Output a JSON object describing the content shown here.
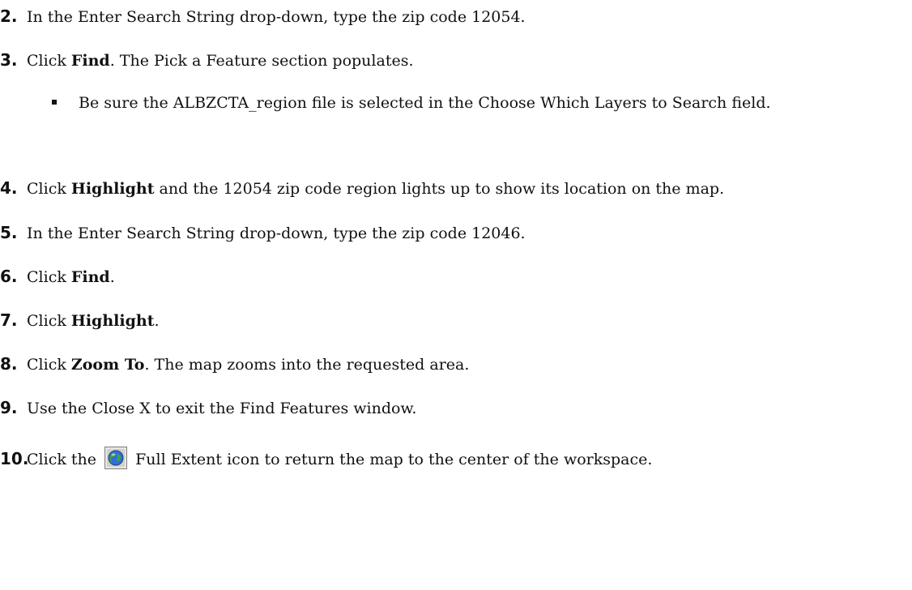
{
  "steps": [
    {
      "number": "2.",
      "text": "In the Enter Search String drop-down, type the zip code 12054."
    },
    {
      "number": "3.",
      "pre": "Click ",
      "bold": "Find",
      "post": ". The Pick a Feature section populates."
    },
    {
      "number": "4.",
      "pre": "Click ",
      "bold": "Highlight",
      "post": " and the 12054 zip code region lights up to show its location on the map."
    },
    {
      "number": "5.",
      "text": "In the Enter Search String drop-down, type the zip code 12046."
    },
    {
      "number": "6.",
      "pre": "Click ",
      "bold": "Find",
      "post": "."
    },
    {
      "number": "7.",
      "pre": "Click ",
      "bold": "Highlight",
      "post": "."
    },
    {
      "number": "8.",
      "pre": "Click ",
      "bold": "Zoom To",
      "post": ". The map zooms into the requested area."
    },
    {
      "number": "9.",
      "text": "Use the Close X to exit the Find Features window."
    },
    {
      "number": "10.",
      "pre": "Click the ",
      "icon": "full-extent-globe-icon",
      "post": " Full Extent icon to return the map to the center of the workspace."
    }
  ],
  "bullet": {
    "text": "Be sure the ALBZCTA_region file is selected in the Choose Which Layers to Search field."
  }
}
